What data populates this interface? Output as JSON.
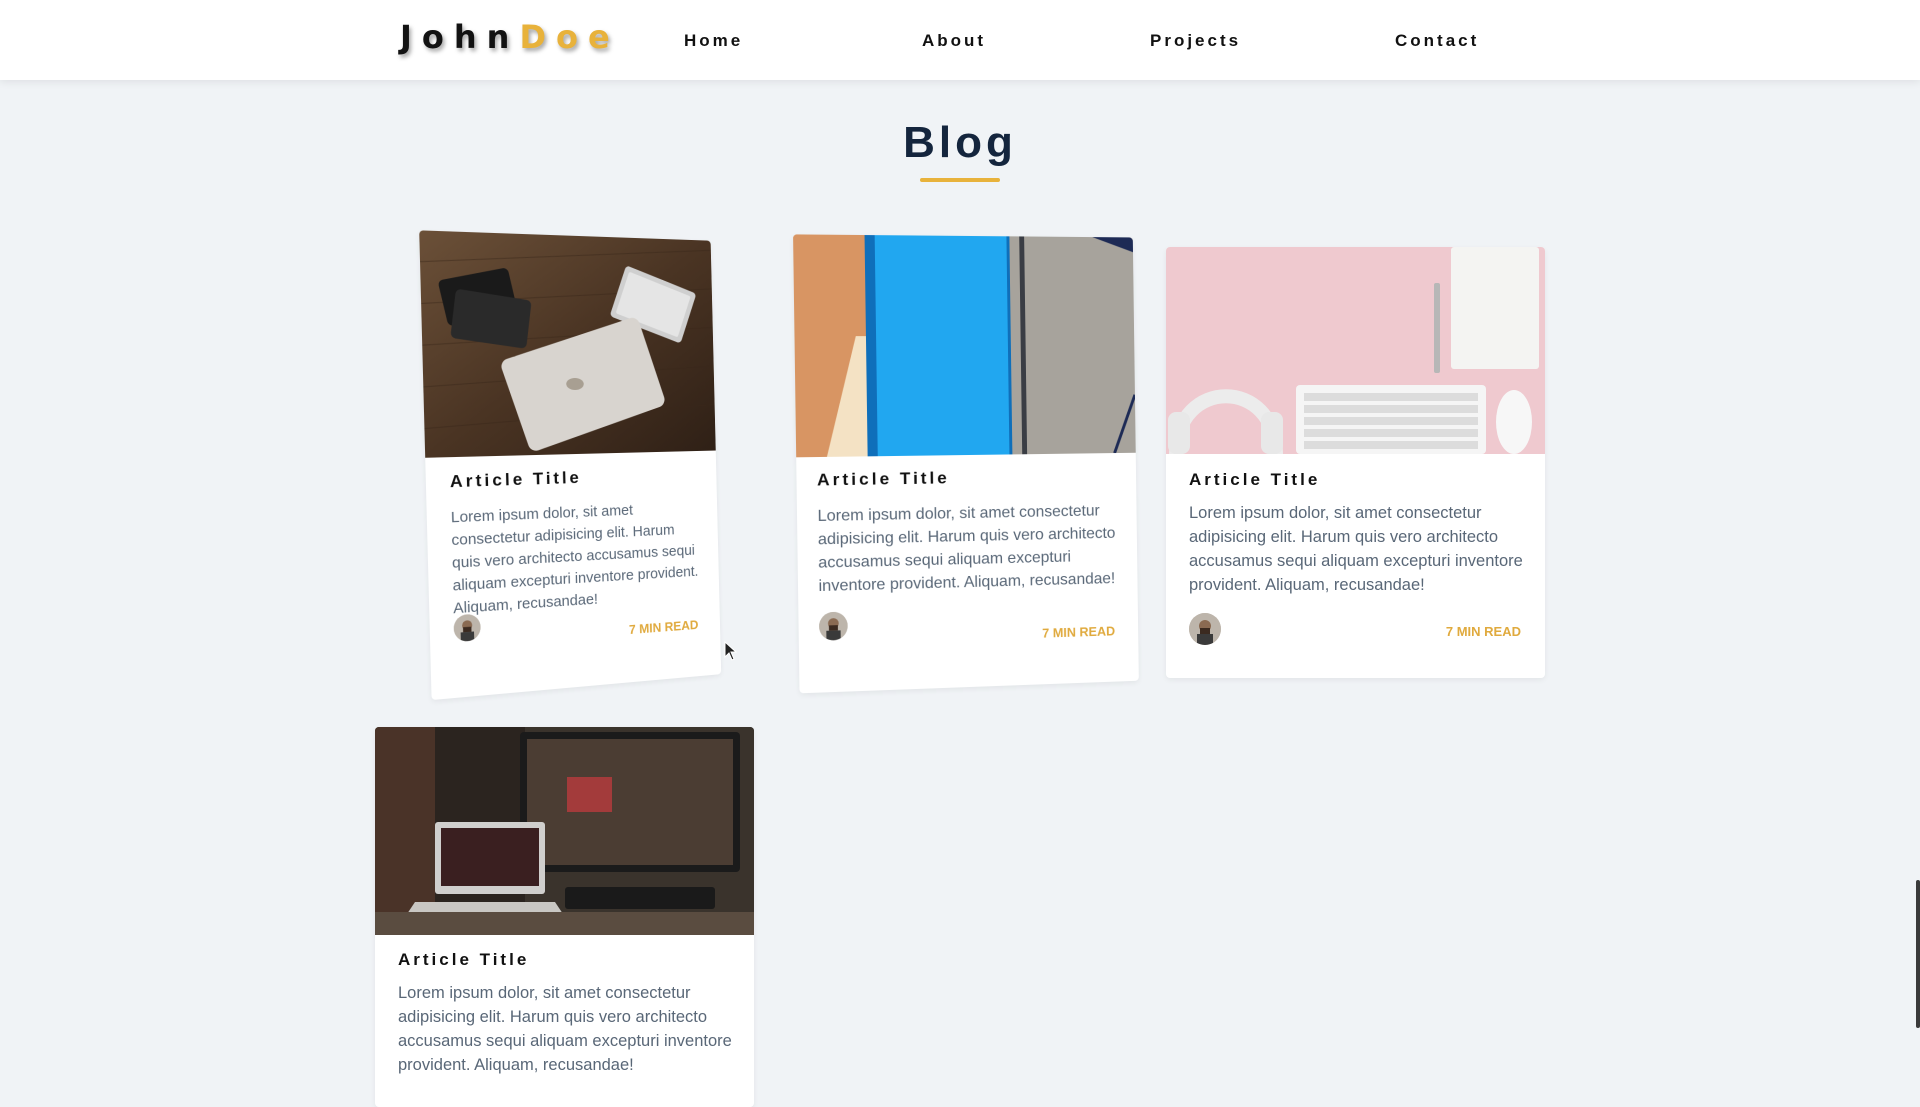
{
  "header": {
    "logo_first": "John",
    "logo_last": "Doe",
    "nav": [
      {
        "label": "Home"
      },
      {
        "label": "About"
      },
      {
        "label": "Projects"
      },
      {
        "label": "Contact"
      }
    ]
  },
  "blog": {
    "title": "Blog",
    "cards": [
      {
        "title": "Article Title",
        "excerpt": "Lorem ipsum dolor, sit amet consectetur adipisicing elit. Harum quis vero architecto accusamus sequi aliquam excepturi inventore provident. Aliquam, recusandae!",
        "read_time": "7 MIN READ"
      },
      {
        "title": "Article Title",
        "excerpt": "Lorem ipsum dolor, sit amet consectetur adipisicing elit. Harum quis vero architecto accusamus sequi aliquam excepturi inventore provident. Aliquam, recusandae!",
        "read_time": "7 MIN READ"
      },
      {
        "title": "Article Title",
        "excerpt": "Lorem ipsum dolor, sit amet consectetur adipisicing elit. Harum quis vero architecto accusamus sequi aliquam excepturi inventore provident. Aliquam, recusandae!",
        "read_time": "7 MIN READ"
      },
      {
        "title": "Article Title",
        "excerpt": "Lorem ipsum dolor, sit amet consectetur adipisicing elit. Harum quis vero architecto accusamus sequi aliquam excepturi inventore provident. Aliquam, recusandae!",
        "read_time": ""
      }
    ]
  },
  "colors": {
    "accent": "#e8b23b",
    "background": "#f0f3f6",
    "heading": "#14253d",
    "body_text": "#596777"
  }
}
